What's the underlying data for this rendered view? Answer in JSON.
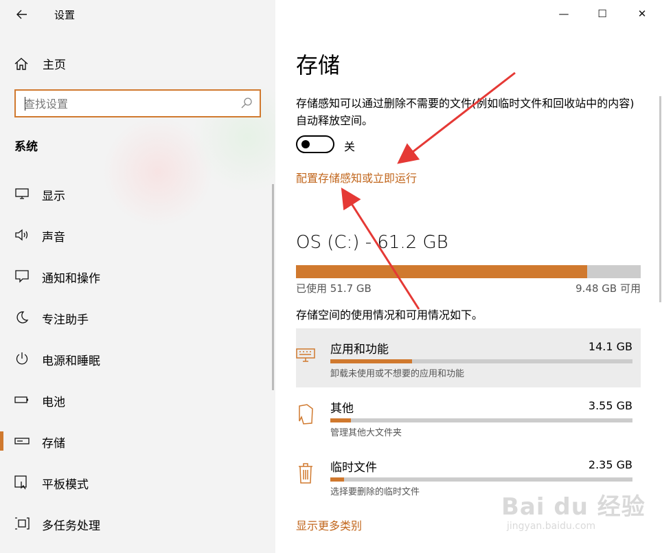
{
  "window": {
    "title": "设置",
    "minimize_glyph": "—",
    "maximize_glyph": "☐",
    "close_glyph": "✕"
  },
  "sidebar": {
    "home_label": "主页",
    "search_placeholder": "查找设置",
    "section_title": "系统",
    "items": [
      {
        "label": "显示",
        "icon": "monitor-icon"
      },
      {
        "label": "声音",
        "icon": "speaker-icon"
      },
      {
        "label": "通知和操作",
        "icon": "notification-icon"
      },
      {
        "label": "专注助手",
        "icon": "moon-icon"
      },
      {
        "label": "电源和睡眠",
        "icon": "power-icon"
      },
      {
        "label": "电池",
        "icon": "battery-icon"
      },
      {
        "label": "存储",
        "icon": "storage-icon"
      },
      {
        "label": "平板模式",
        "icon": "tablet-icon"
      },
      {
        "label": "多任务处理",
        "icon": "multitask-icon"
      }
    ],
    "active_item": "存储"
  },
  "main": {
    "title": "存储",
    "storage_sense_desc": "存储感知可以通过删除不需要的文件(例如临时文件和回收站中的内容)自动释放空间。",
    "toggle_state": "关",
    "configure_link": "配置存储感知或立即运行",
    "drive_name": "OS (C:) - 61.2 GB",
    "used_label": "已使用 51.7 GB",
    "free_label": "9.48 GB 可用",
    "used_fraction": 0.845,
    "usage_subhead": "存储空间的使用情况和可用情况如下。",
    "categories": [
      {
        "name": "应用和功能",
        "size": "14.1 GB",
        "desc": "卸载未使用或不想要的应用和功能",
        "fraction": 0.27,
        "icon": "keyboard-icon"
      },
      {
        "name": "其他",
        "size": "3.55 GB",
        "desc": "管理其他大文件夹",
        "fraction": 0.068,
        "icon": "file-icon"
      },
      {
        "name": "临时文件",
        "size": "2.35 GB",
        "desc": "选择要删除的临时文件",
        "fraction": 0.045,
        "icon": "trash-icon"
      }
    ],
    "show_more_link": "显示更多类别"
  },
  "watermark": {
    "line1": "Bai du 经验",
    "line2": "jingyan.baidu.com"
  },
  "colors": {
    "accent": "#d0792e",
    "link": "#c1661c",
    "annotation_arrow": "#e53935"
  }
}
